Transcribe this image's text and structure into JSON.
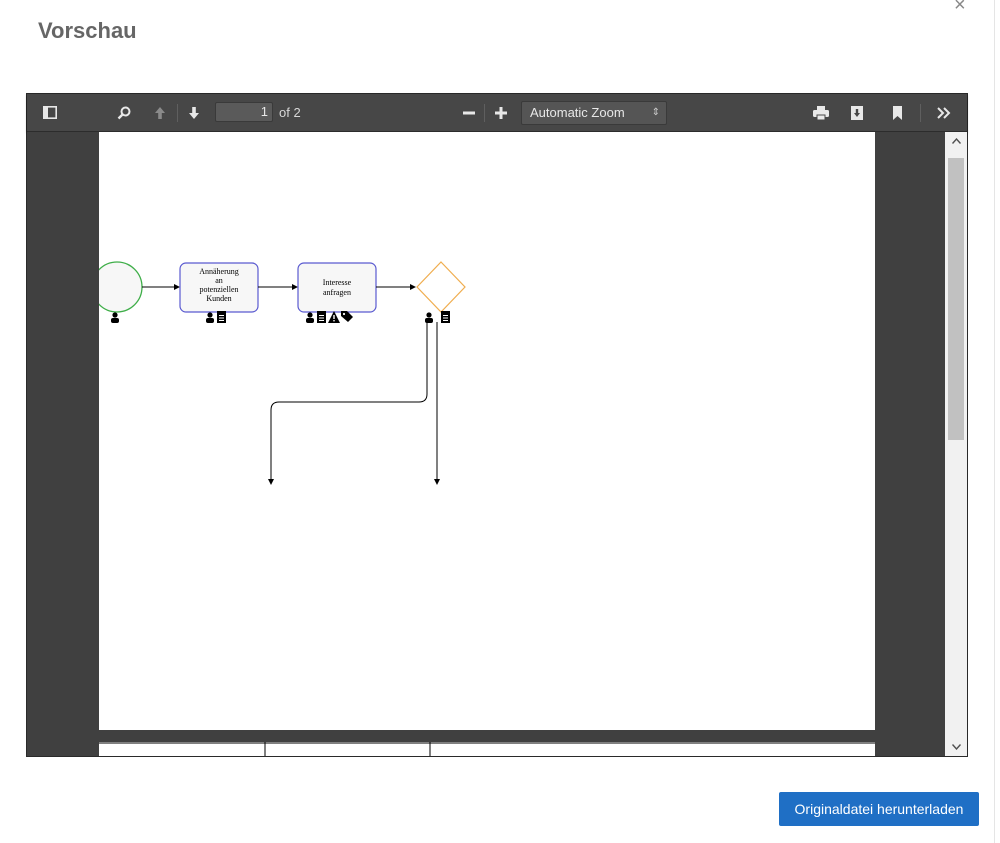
{
  "dialog": {
    "title": "Vorschau",
    "close_label": "×",
    "download_button": "Originaldatei herunterladen"
  },
  "viewer": {
    "toolbar": {
      "page_number": "1",
      "page_count_label": "of 2",
      "zoom_value": "Automatic Zoom"
    },
    "diagram": {
      "task1_lines": [
        "Annäherung",
        "an",
        "potenziellen",
        "Kunden"
      ],
      "task2_lines": [
        "Interesse",
        "anfragen"
      ]
    }
  },
  "colors": {
    "primary_button": "#1f6fc5",
    "start_event": "#3fae49",
    "task_border": "#5a5ad0",
    "gateway": "#f0ad4e"
  },
  "icons": [
    "sidebar-toggle-icon",
    "search-icon",
    "previous-page-icon",
    "next-page-icon",
    "zoom-out-icon",
    "zoom-in-icon",
    "print-icon",
    "download-icon",
    "bookmark-icon",
    "tools-icon",
    "person-icon",
    "document-icon",
    "warning-icon",
    "tag-icon"
  ]
}
